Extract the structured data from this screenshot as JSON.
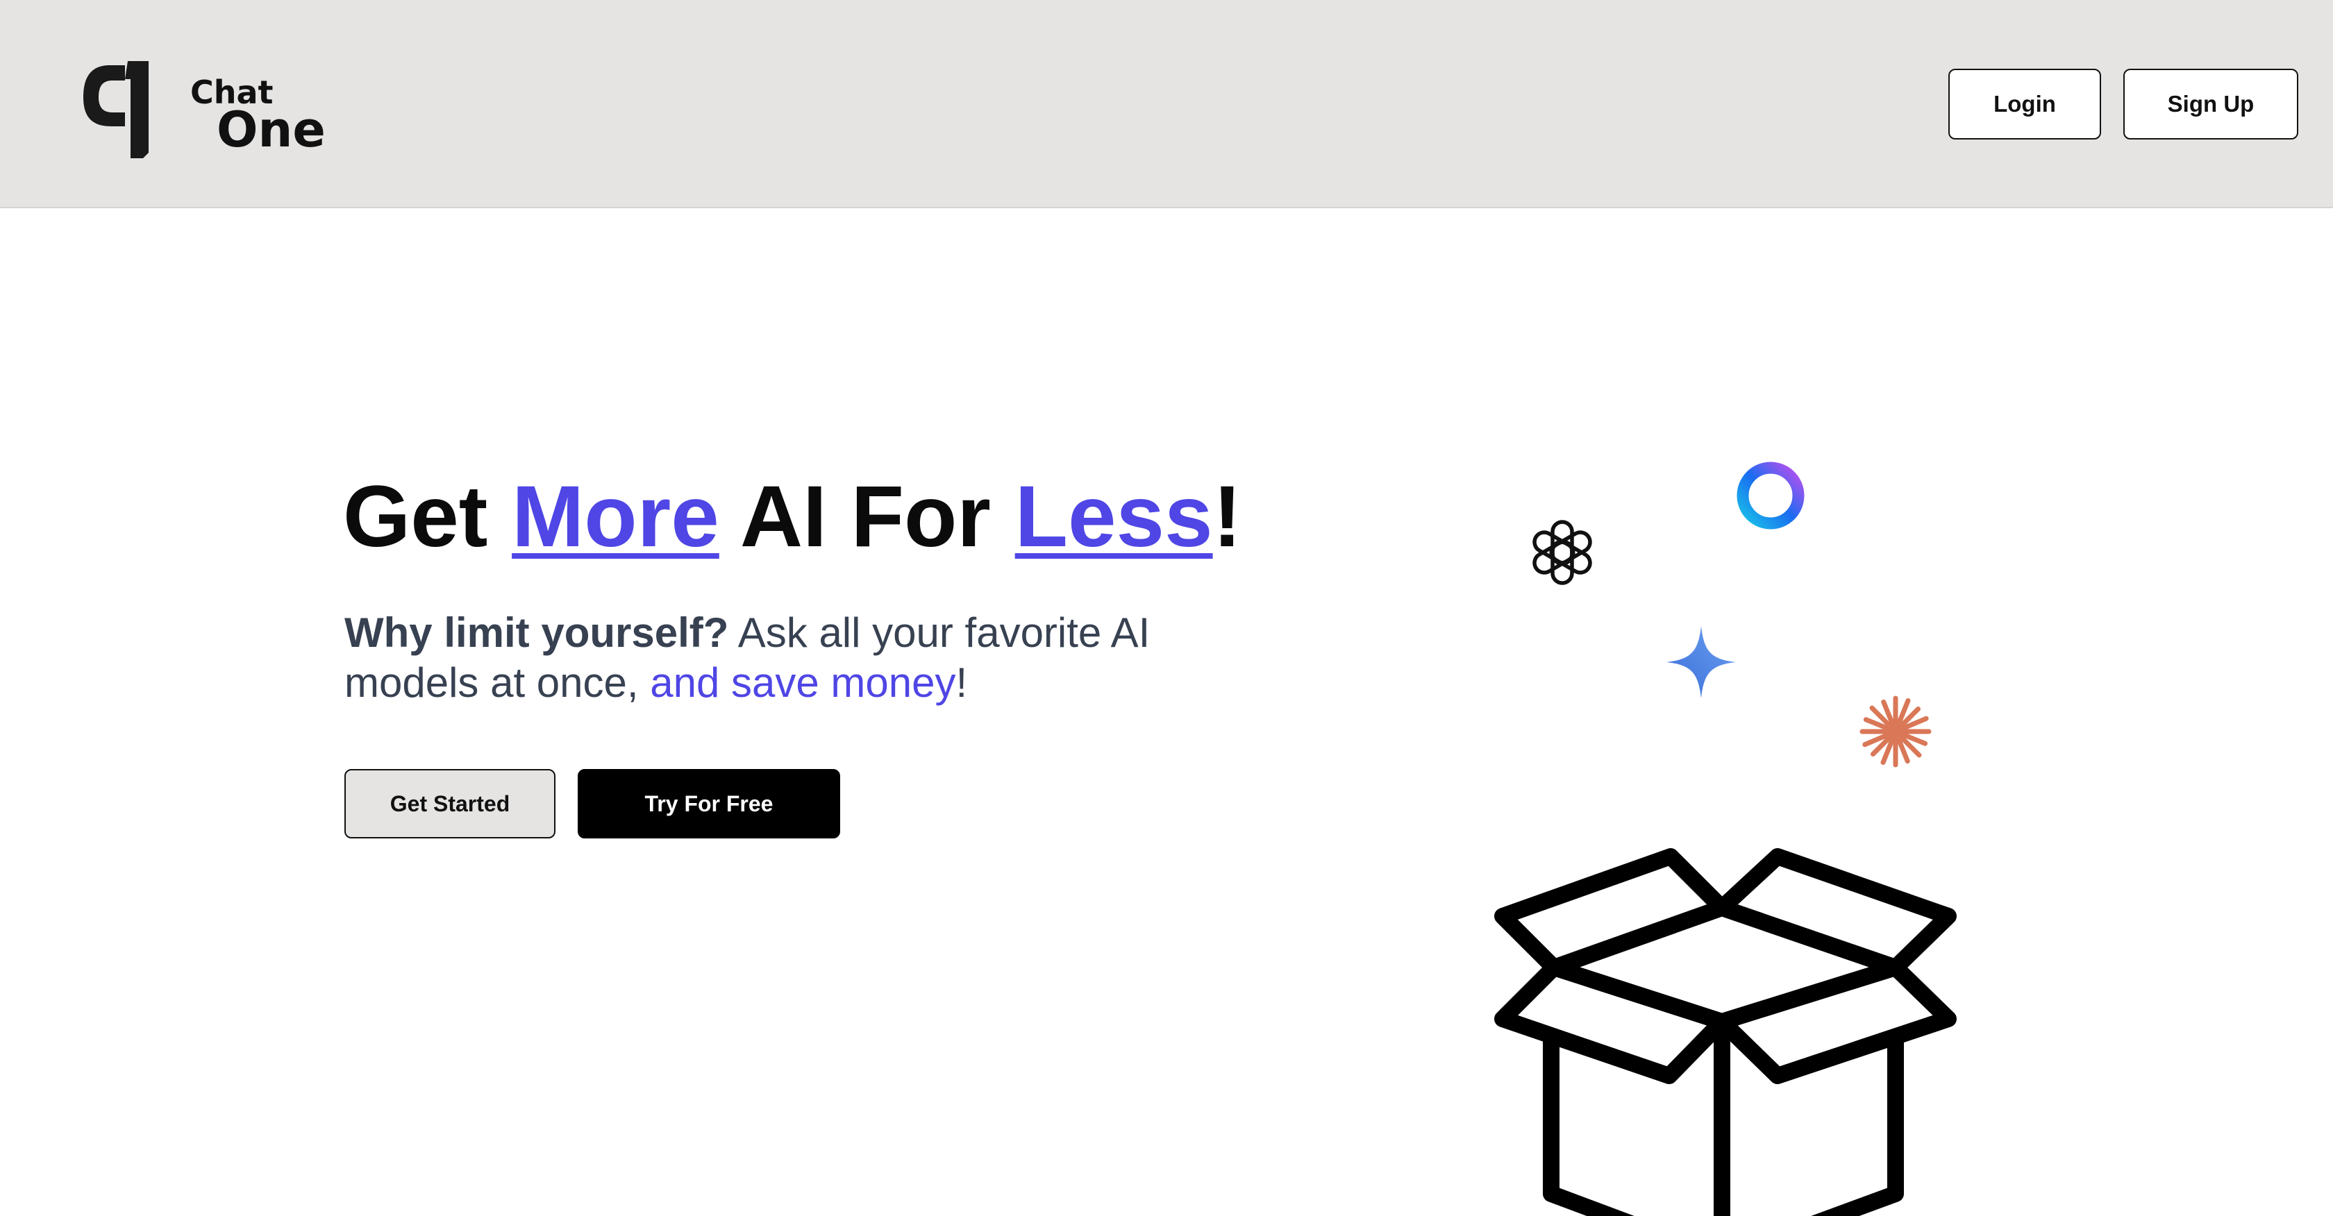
{
  "header": {
    "logo": {
      "line1": "Chat",
      "line2": "One"
    },
    "login_label": "Login",
    "signup_label": "Sign Up"
  },
  "hero": {
    "title": {
      "part1": "Get ",
      "highlight1": "More",
      "part2": " AI For ",
      "highlight2": "Less",
      "part3": "!"
    },
    "subtitle": {
      "bold": "Why limit yourself?",
      "text": " Ask all your favorite AI models at once, ",
      "accent": "and save money",
      "end": "!"
    },
    "get_started_label": "Get Started",
    "try_free_label": "Try For Free"
  },
  "illustration": {
    "icons": [
      "openai-icon",
      "ring-icon",
      "gemini-sparkle-icon",
      "claude-starburst-icon",
      "open-box-icon"
    ]
  },
  "colors": {
    "accent": "#4f46e5",
    "header_bg": "#e5e4e3",
    "claude_orange": "#d97757",
    "gemini_blue": "#4f86e0"
  }
}
